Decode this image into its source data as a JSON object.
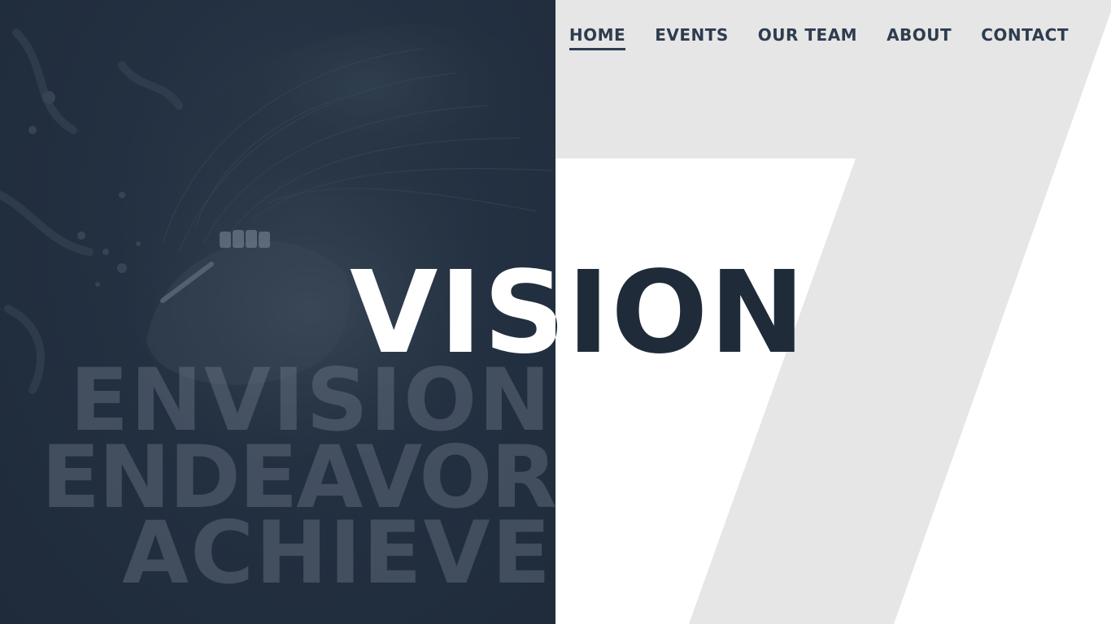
{
  "nav": {
    "items": [
      {
        "label": "HOME",
        "active": true
      },
      {
        "label": "EVENTS",
        "active": false
      },
      {
        "label": "OUR TEAM",
        "active": false
      },
      {
        "label": "ABOUT",
        "active": false
      },
      {
        "label": "CONTACT",
        "active": false
      }
    ]
  },
  "hero": {
    "headline": "VISION",
    "background_words": [
      "ENVISION",
      "ENDEAVOR",
      "ACHIEVE"
    ]
  },
  "colors": {
    "dark_panel": "#223040",
    "navy_text": "#202b39",
    "nav_text": "#2e3c4f",
    "seven_shape": "#e6e6e6",
    "page_bg": "#ffffff"
  }
}
